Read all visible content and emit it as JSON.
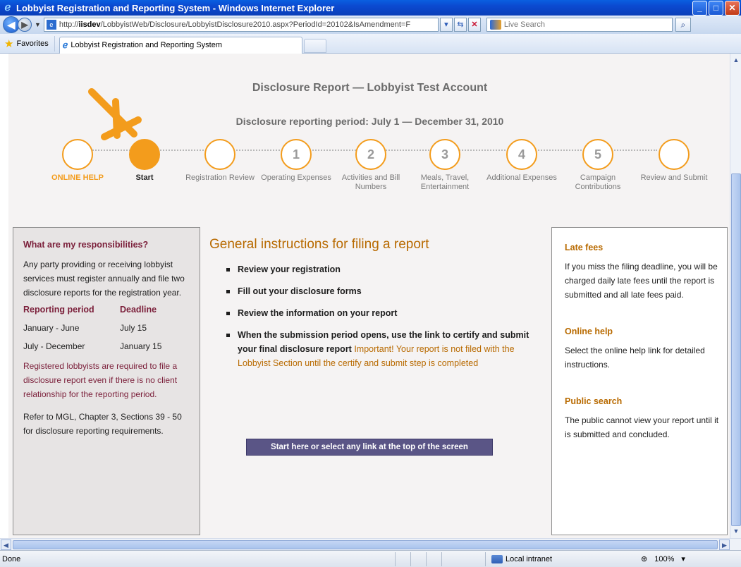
{
  "window": {
    "title": "Lobbyist Registration and Reporting System - Windows Internet Explorer"
  },
  "address": {
    "url_prefix": "http://",
    "url_host": "iisdev",
    "url_rest": "/LobbyistWeb/Disclosure/LobbyistDisclosure2010.aspx?PeriodId=20102&IsAmendment=F",
    "search_placeholder": "Live Search"
  },
  "favbar": {
    "favorites_label": "Favorites",
    "tab_title": "Lobbyist Registration and Reporting System"
  },
  "page": {
    "title": "Disclosure Report — Lobbyist Test Account",
    "period": "Disclosure reporting period: July 1 — December 31, 2010"
  },
  "steps": [
    {
      "num": "",
      "label": "ONLINE HELP"
    },
    {
      "num": "",
      "label": "Start"
    },
    {
      "num": "",
      "label": "Registration Review"
    },
    {
      "num": "1",
      "label": "Operating Expenses"
    },
    {
      "num": "2",
      "label": "Activities and Bill Numbers"
    },
    {
      "num": "3",
      "label": "Meals, Travel, Entertainment"
    },
    {
      "num": "4",
      "label": "Additional Expenses"
    },
    {
      "num": "5",
      "label": "Campaign Contributions"
    },
    {
      "num": "",
      "label": "Review and Submit"
    }
  ],
  "left_panel": {
    "heading": "What are my responsibilities?",
    "intro": "Any party providing or receiving lobbyist services must register annually and file two disclosure reports for the registration year.",
    "col_period": "Reporting period",
    "col_deadline": "Deadline",
    "rows": [
      {
        "period": "January - June",
        "deadline": "July 15"
      },
      {
        "period": "July - December",
        "deadline": "January 15"
      }
    ],
    "note": "Registered lobbyists are required to file a disclosure report even if there is no client relationship for the reporting period.",
    "reference": "Refer to MGL, Chapter 3, Sections 39 - 50 for disclosure reporting requirements."
  },
  "center": {
    "heading": "General instructions for filing a report",
    "items": [
      "Review your registration",
      "Fill out your disclosure forms",
      "Review the information on your report",
      "When the submission period opens, use the link to certify and submit your final disclosure report"
    ],
    "important": "Important! Your report is not filed with the Lobbyist Section until the certify and submit step is completed",
    "start_button": "Start here or select any link at the top of the screen"
  },
  "right_panel": {
    "late_fees_heading": "Late fees",
    "late_fees_text": "If you miss the filing deadline, you will be charged daily late fees until the report is submitted and all late fees paid.",
    "online_help_heading": "Online help",
    "online_help_text": "Select the online help link for detailed instructions.",
    "public_search_heading": "Public search",
    "public_search_text": "The public cannot view your report until it is submitted and concluded."
  },
  "status": {
    "text": "Done",
    "zone": "Local intranet",
    "zoom": "100%"
  },
  "colors": {
    "accent_orange": "#f39c1c",
    "heading_maroon": "#7b1f3a",
    "button_purple": "#5a5586"
  }
}
